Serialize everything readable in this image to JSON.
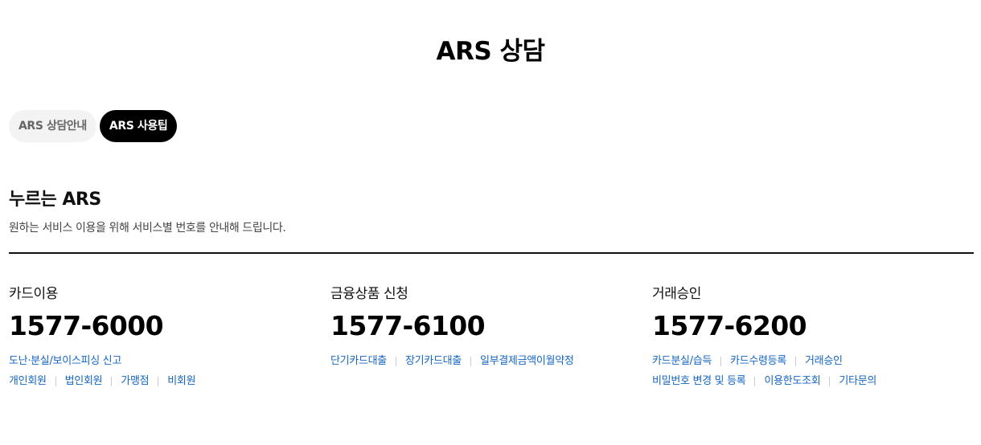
{
  "page": {
    "title": "ARS 상담"
  },
  "tabs": [
    {
      "label": "ARS 상담안내",
      "active": false
    },
    {
      "label": "ARS 사용팁",
      "active": true
    }
  ],
  "section": {
    "title": "누르는 ARS",
    "description": "원하는 서비스 이용을 위해 서비스별 번호를 안내해 드립니다."
  },
  "cards": [
    {
      "label": "카드이용",
      "number": "1577-6000",
      "links": [
        [
          "도난·분실/보이스피싱 신고"
        ],
        [
          "개인회원",
          "법인회원",
          "가맹점",
          "비회원"
        ]
      ]
    },
    {
      "label": "금융상품 신청",
      "number": "1577-6100",
      "links": [
        [
          "단기카드대출",
          "장기카드대출",
          "일부결제금액이월약정"
        ]
      ]
    },
    {
      "label": "거래승인",
      "number": "1577-6200",
      "links": [
        [
          "카드분실/습득",
          "카드수령등록",
          "거래승인"
        ],
        [
          "비밀번호 변경 및 등록",
          "이용한도조회",
          "기타문의"
        ]
      ]
    }
  ],
  "colors": {
    "link": "#1565c0",
    "active_tab_bg": "#000000",
    "inactive_tab_bg": "#f3f3f3"
  }
}
